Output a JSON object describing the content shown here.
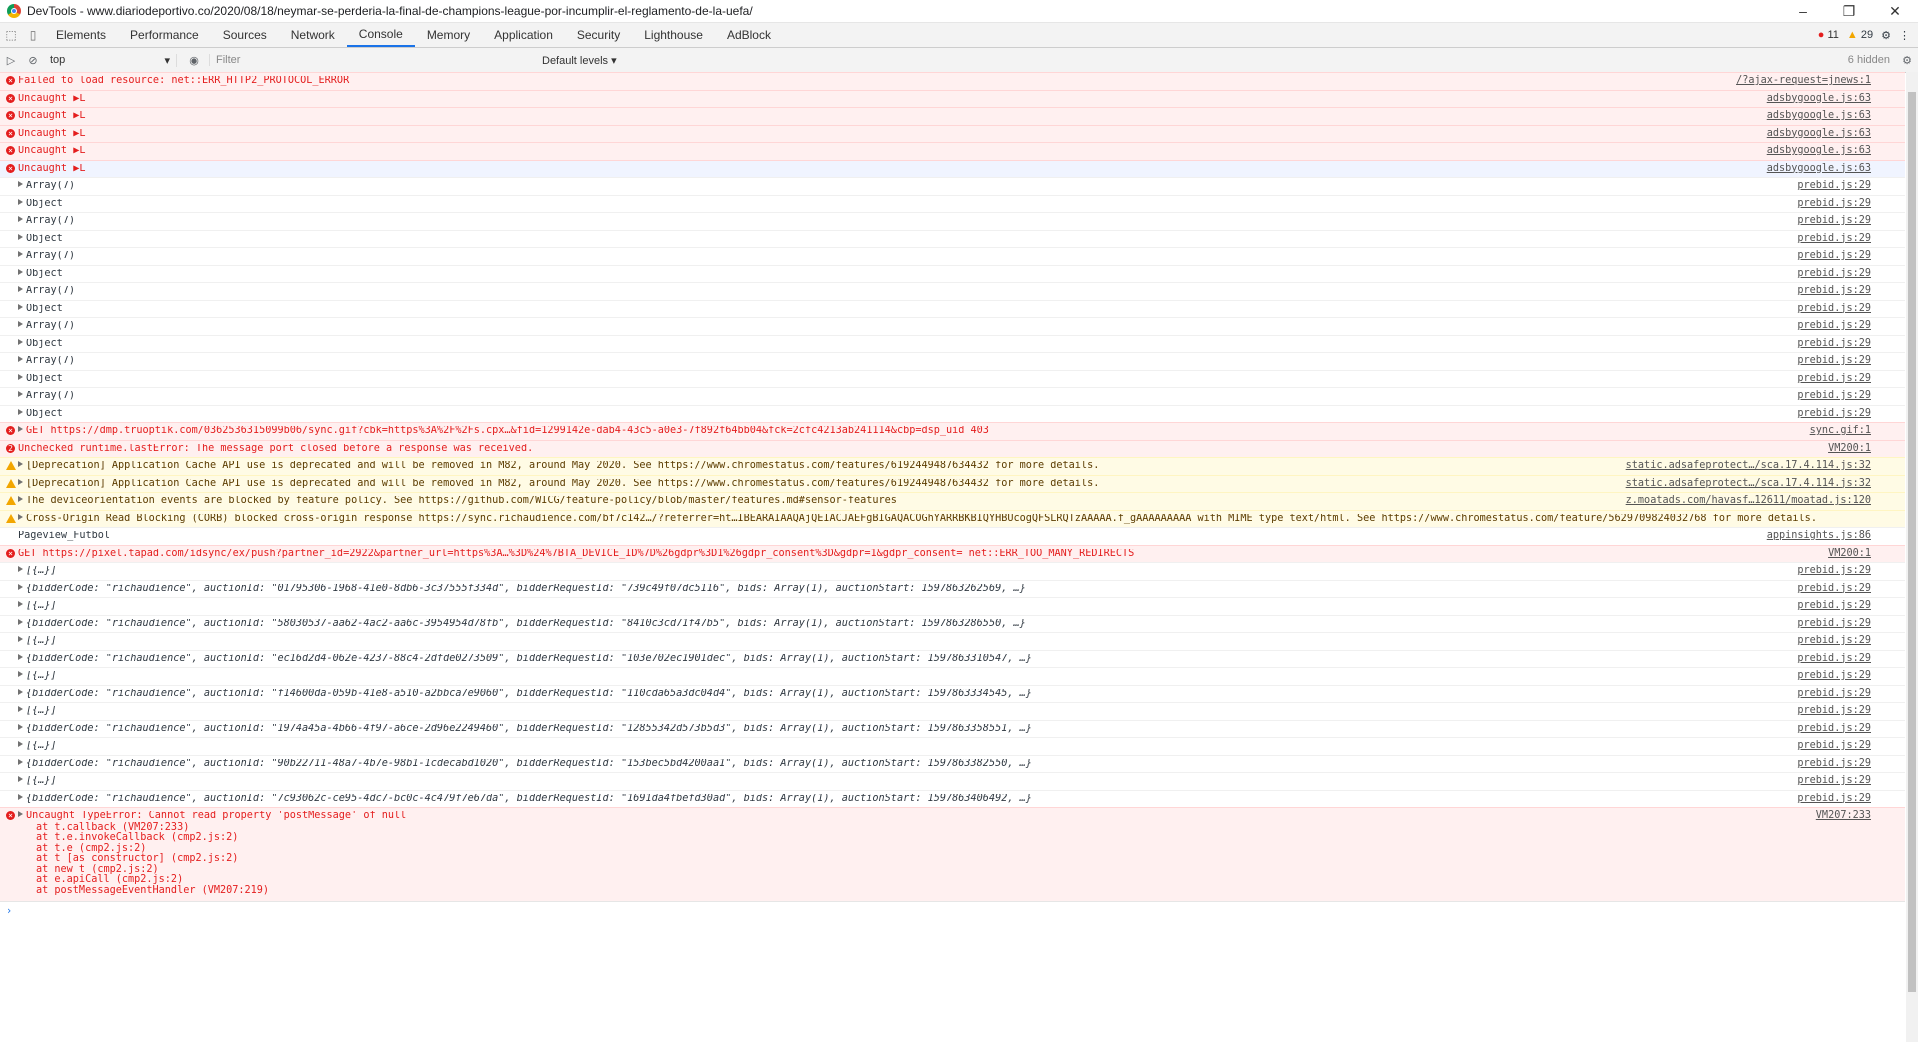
{
  "window": {
    "title": "DevTools - www.diariodeportivo.co/2020/08/18/neymar-se-perderia-la-final-de-champions-league-por-incumplir-el-reglamento-de-la-uefa/",
    "controls": [
      "–",
      "❐",
      "✕"
    ]
  },
  "tabs": [
    "Elements",
    "Performance",
    "Sources",
    "Network",
    "Console",
    "Memory",
    "Application",
    "Security",
    "Lighthouse",
    "AdBlock"
  ],
  "active_tab": "Console",
  "counts": {
    "errors": "11",
    "warnings": "29"
  },
  "toolbar": {
    "context": "top",
    "filter_placeholder": "Filter",
    "levels": "Default levels ▾",
    "hidden": "6 hidden"
  },
  "messages": [
    {
      "type": "error",
      "text": "Failed to load resource: net::ERR_HTTP2_PROTOCOL_ERROR",
      "src": "/?ajax-request=jnews:1"
    },
    {
      "type": "error",
      "text": "Uncaught ▶L",
      "src": "adsbygoogle.js:63"
    },
    {
      "type": "error",
      "text": "Uncaught ▶L",
      "src": "adsbygoogle.js:63"
    },
    {
      "type": "error",
      "text": "Uncaught ▶L",
      "src": "adsbygoogle.js:63"
    },
    {
      "type": "error",
      "text": "Uncaught ▶L",
      "src": "adsbygoogle.js:63"
    },
    {
      "type": "error selected",
      "text": "Uncaught ▶L",
      "src": "adsbygoogle.js:63"
    },
    {
      "type": "info",
      "caret": true,
      "text": "Array(7)",
      "src": "prebid.js:29"
    },
    {
      "type": "info",
      "caret": true,
      "text": "Object",
      "src": "prebid.js:29"
    },
    {
      "type": "info",
      "caret": true,
      "text": "Array(7)",
      "src": "prebid.js:29"
    },
    {
      "type": "info",
      "caret": true,
      "text": "Object",
      "src": "prebid.js:29"
    },
    {
      "type": "info",
      "caret": true,
      "text": "Array(7)",
      "src": "prebid.js:29"
    },
    {
      "type": "info",
      "caret": true,
      "text": "Object",
      "src": "prebid.js:29"
    },
    {
      "type": "info",
      "caret": true,
      "text": "Array(7)",
      "src": "prebid.js:29"
    },
    {
      "type": "info",
      "caret": true,
      "text": "Object",
      "src": "prebid.js:29"
    },
    {
      "type": "info",
      "caret": true,
      "text": "Array(7)",
      "src": "prebid.js:29"
    },
    {
      "type": "info",
      "caret": true,
      "text": "Object",
      "src": "prebid.js:29"
    },
    {
      "type": "info",
      "caret": true,
      "text": "Array(7)",
      "src": "prebid.js:29"
    },
    {
      "type": "info",
      "caret": true,
      "text": "Object",
      "src": "prebid.js:29"
    },
    {
      "type": "info",
      "caret": true,
      "text": "Array(7)",
      "src": "prebid.js:29"
    },
    {
      "type": "info",
      "caret": true,
      "text": "Object",
      "src": "prebid.js:29"
    },
    {
      "type": "error",
      "caret": true,
      "text": "GET https://dmp.truoptik.com/0362536315099b06/sync.gif?cbk=https%3A%2F%2Fs.cpx…&fid=1299142e-dab4-43c5-a0e3-7f892f64bb04&fck=2cfc4213ab241114&cbp=dsp_uid 403",
      "src": "sync.gif:1"
    },
    {
      "type": "error",
      "badge": "2",
      "text": "Unchecked runtime.lastError: The message port closed before a response was received.",
      "src": "VM200:1"
    },
    {
      "type": "warning",
      "caret": true,
      "text": "[Deprecation] Application Cache API use is deprecated and will be removed in M82, around May 2020. See https://www.chromestatus.com/features/6192449487634432 for more details.",
      "src": "static.adsafeprotect…/sca.17.4.114.js:32"
    },
    {
      "type": "warning",
      "caret": true,
      "text": "[Deprecation] Application Cache API use is deprecated and will be removed in M82, around May 2020. See https://www.chromestatus.com/features/6192449487634432 for more details.",
      "src": "static.adsafeprotect…/sca.17.4.114.js:32"
    },
    {
      "type": "warning",
      "caret": true,
      "text": "The deviceorientation events are blocked by feature policy. See https://github.com/WICG/feature-policy/blob/master/features.md#sensor-features",
      "src": "z.moatads.com/havasf…12611/moatad.js:120"
    },
    {
      "type": "warning",
      "caret": true,
      "text": "Cross-Origin Read Blocking (CORB) blocked cross-origin response https://sync.richaudience.com/bf7c142…/?referrer=ht…IBEARAIAAQAjQEIACJAEFgBIGAQACOGhYARRBKBIQYHBUcogQFSLRQTzAAAAA.f_gAAAAAAAAA with MIME type text/html. See https://www.chromestatus.com/feature/5629709824032768 for more details.",
      "src": ""
    },
    {
      "type": "info",
      "text": "Pageview_Futbol",
      "src": "appinsights.js:86"
    },
    {
      "type": "error",
      "text": "GET https://pixel.tapad.com/idsync/ex/push?partner_id=2922&partner_url=https%3A…%3D%24%7BTA_DEVICE_ID%7D%26gdpr%3D1%26gdpr_consent%3D&gdpr=1&gdpr_consent= net::ERR_TOO_MANY_REDIRECTS",
      "src": "VM200:1"
    },
    {
      "type": "info",
      "caret": true,
      "text": "[{…}]",
      "src": "prebid.js:29"
    },
    {
      "type": "info",
      "caret": true,
      "text": "{bidderCode: \"richaudience\", auctionId: \"01795306-1968-41e0-8db6-3c37555f334d\", bidderRequestId: \"739c49f07dc5116\", bids: Array(1), auctionStart: 1597863262569, …}",
      "src": "prebid.js:29"
    },
    {
      "type": "info",
      "caret": true,
      "text": "[{…}]",
      "src": "prebid.js:29"
    },
    {
      "type": "info",
      "caret": true,
      "text": "{bidderCode: \"richaudience\", auctionId: \"58030537-aa62-4ac2-aa6c-3954954d78fb\", bidderRequestId: \"8410c3cd71f47b5\", bids: Array(1), auctionStart: 1597863286550, …}",
      "src": "prebid.js:29"
    },
    {
      "type": "info",
      "caret": true,
      "text": "[{…}]",
      "src": "prebid.js:29"
    },
    {
      "type": "info",
      "caret": true,
      "text": "{bidderCode: \"richaudience\", auctionId: \"ec16d2d4-062e-4237-88c4-2dfde0273509\", bidderRequestId: \"103e702ec1901dec\", bids: Array(1), auctionStart: 1597863310547, …}",
      "src": "prebid.js:29"
    },
    {
      "type": "info",
      "caret": true,
      "text": "[{…}]",
      "src": "prebid.js:29"
    },
    {
      "type": "info",
      "caret": true,
      "text": "{bidderCode: \"richaudience\", auctionId: \"f14600da-059b-41e8-a510-a2bbca7e9060\", bidderRequestId: \"110cda65a3dc04d4\", bids: Array(1), auctionStart: 1597863334545, …}",
      "src": "prebid.js:29"
    },
    {
      "type": "info",
      "caret": true,
      "text": "[{…}]",
      "src": "prebid.js:29"
    },
    {
      "type": "info",
      "caret": true,
      "text": "{bidderCode: \"richaudience\", auctionId: \"1974a45a-4b66-4f97-a6ce-2d96e2249460\", bidderRequestId: \"12855342d573b5d3\", bids: Array(1), auctionStart: 1597863358551, …}",
      "src": "prebid.js:29"
    },
    {
      "type": "info",
      "caret": true,
      "text": "[{…}]",
      "src": "prebid.js:29"
    },
    {
      "type": "info",
      "caret": true,
      "text": "{bidderCode: \"richaudience\", auctionId: \"90b22711-48a7-4b7e-98b1-1cdecabd1020\", bidderRequestId: \"153bec5bd4200aa1\", bids: Array(1), auctionStart: 1597863382550, …}",
      "src": "prebid.js:29"
    },
    {
      "type": "info",
      "caret": true,
      "text": "[{…}]",
      "src": "prebid.js:29"
    },
    {
      "type": "info",
      "caret": true,
      "text": "{bidderCode: \"richaudience\", auctionId: \"7c93062c-ce95-4dc7-bc0c-4c479f7e67da\", bidderRequestId: \"1691da4fbefd30ad\", bids: Array(1), auctionStart: 1597863406492, …}",
      "src": "prebid.js:29"
    }
  ],
  "final_error": {
    "title": "Uncaught TypeError: Cannot read property 'postMessage' of null",
    "src": "VM207:233",
    "stack": [
      "at t.callback (VM207:233)",
      "at t.e.invokeCallback (cmp2.js:2)",
      "at t.e (cmp2.js:2)",
      "at t [as constructor] (cmp2.js:2)",
      "at new t (cmp2.js:2)",
      "at e.apiCall (cmp2.js:2)",
      "at postMessageEventHandler (VM207:219)"
    ]
  },
  "prompt": "›",
  "colors": {
    "error": "#e41e1e",
    "warning": "#f2a600",
    "accent": "#1a73e8"
  }
}
